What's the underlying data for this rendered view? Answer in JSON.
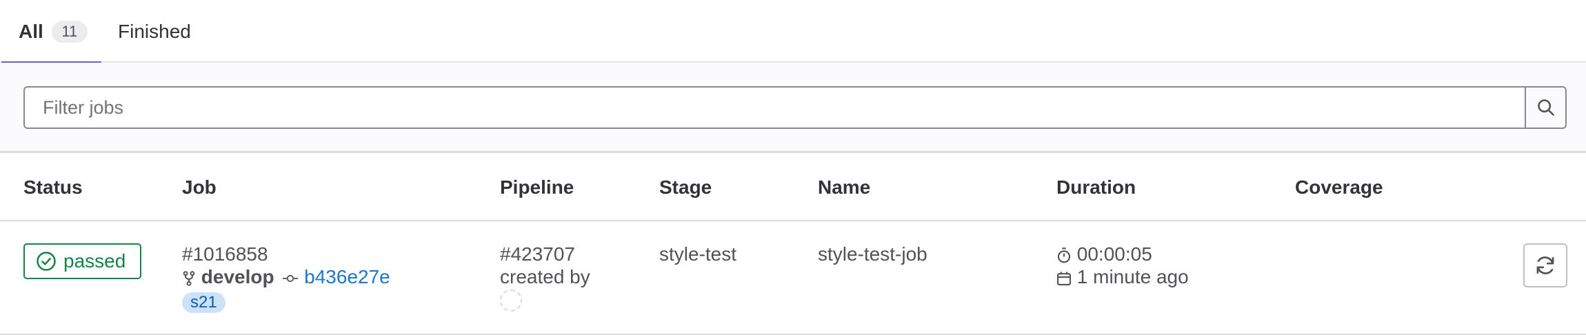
{
  "tabs": [
    {
      "label": "All",
      "count": "11"
    },
    {
      "label": "Finished"
    }
  ],
  "filter": {
    "placeholder": "Filter jobs",
    "search_icon": "search-icon"
  },
  "table": {
    "headers": [
      "Status",
      "Job",
      "Pipeline",
      "Stage",
      "Name",
      "Duration",
      "Coverage"
    ],
    "rows": [
      {
        "status": "passed",
        "job_id": "#1016858",
        "branch": "develop",
        "commit": "b436e27e",
        "tag": "s21",
        "pipeline_id": "#423707",
        "pipeline_created_by": "created by",
        "stage": "style-test",
        "name": "style-test-job",
        "duration": "00:00:05",
        "finished": "1 minute ago",
        "coverage": ""
      }
    ]
  },
  "colors": {
    "accent": "#6e62ce",
    "success": "#108548",
    "link": "#1f75cb",
    "tag_bg": "#cbe2f9"
  }
}
